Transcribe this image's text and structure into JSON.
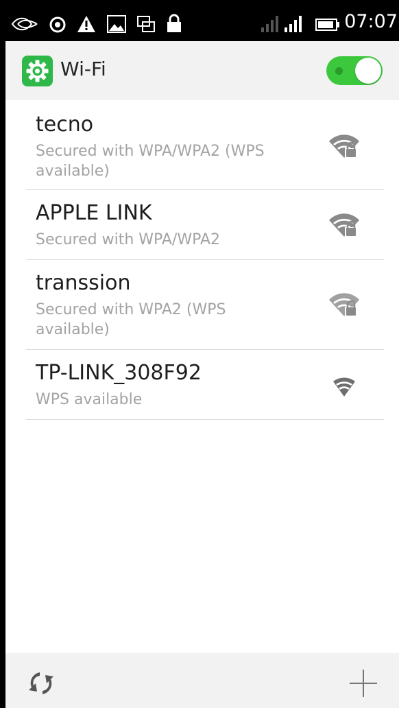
{
  "status_bar": {
    "time": "07:07",
    "icons": [
      "swype-icon",
      "sync-circle-icon",
      "warning-icon",
      "image-icon",
      "screen-icon",
      "lock-icon",
      "signal-icon",
      "signal-icon",
      "battery-icon"
    ],
    "text_color": "#ffffff",
    "background": "#000000"
  },
  "header": {
    "title": "Wi-Fi",
    "app_icon": "settings-gear-icon",
    "toggle_on": true,
    "accent": "#3cc83c"
  },
  "networks": [
    {
      "name": "tecno",
      "status": "Secured with WPA/WPA2 (WPS available)",
      "signal_icon": "wifi-locked-icon",
      "secured": true
    },
    {
      "name": "APPLE LINK",
      "status": "Secured with WPA/WPA2",
      "signal_icon": "wifi-locked-icon",
      "secured": true
    },
    {
      "name": "transsion",
      "status": "Secured with WPA2 (WPS available)",
      "signal_icon": "wifi-locked-icon",
      "secured": true
    },
    {
      "name": "TP-LINK_308F92",
      "status": "WPS available",
      "signal_icon": "wifi-icon",
      "secured": false
    }
  ],
  "bottom_bar": {
    "left_icon": "refresh-icon",
    "right_icon": "add-icon"
  }
}
